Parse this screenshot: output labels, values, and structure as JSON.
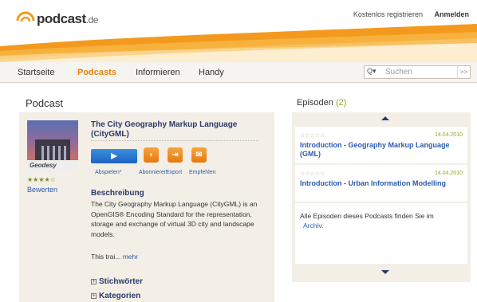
{
  "header": {
    "logo_main": "podcast",
    "logo_suffix": ".de",
    "register_label": "Kostenlos registrieren",
    "login_label": "Anmelden"
  },
  "nav": {
    "items": [
      "Startseite",
      "Podcasts",
      "Informieren",
      "Handy"
    ],
    "active": "Podcasts",
    "search_placeholder": "Suchen",
    "search_icon": "Q▾",
    "search_go": ">>"
  },
  "podcast": {
    "section_title": "Podcast",
    "title": "The City Geography Markup Language (CityGML)",
    "cover_label": "Geodesy",
    "stars": "★★★★☆",
    "rate_label": "Bewerten",
    "actions": {
      "play": "Abspielen*",
      "subscribe": "Abonnieren",
      "export": "Export",
      "recommend": "Empfehlen"
    },
    "description_heading": "Beschreibung",
    "description": "The City Geography Markup Language (CityGML) is an OpenGIS® Encoding Standard for the representation, storage and exchange of virtual 3D city and landscape models.",
    "teaser": "This trai...",
    "more_label": "mehr",
    "keywords_label": "Stichwörter",
    "categories_label": "Kategorien"
  },
  "episodes": {
    "title": "Episoden",
    "count": "(2)",
    "items": [
      {
        "stars": "☆☆☆☆☆",
        "date": "14.04.2010",
        "title": "Introduction - Geography Markup Language (GML)"
      },
      {
        "stars": "☆☆☆☆☆",
        "date": "14.04.2010",
        "title": "Introduction - Urban Information Modelling"
      }
    ],
    "all_text": "Alle Episoden dieses Podcasts finden Sie im",
    "archive_label": "Archiv."
  },
  "colors": {
    "accent": "#e8820c",
    "link": "#2a5bb0",
    "green": "#8fae1b",
    "panel": "#f3efe7"
  }
}
